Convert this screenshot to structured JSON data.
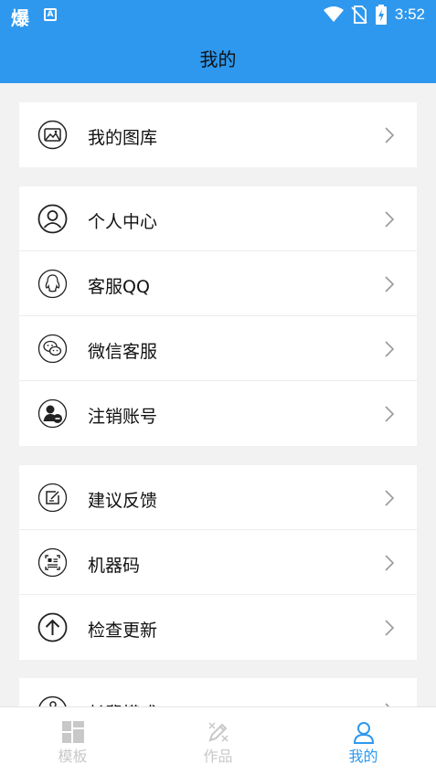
{
  "statusbar": {
    "app_glyph": "爆",
    "store_glyph": "A",
    "time": "3:52"
  },
  "header": {
    "title": "我的"
  },
  "menu_groups": [
    {
      "items": [
        {
          "label": "我的图库",
          "icon": "gallery-icon"
        }
      ]
    },
    {
      "items": [
        {
          "label": "个人中心",
          "icon": "user-icon"
        },
        {
          "label": "客服QQ",
          "icon": "qq-icon"
        },
        {
          "label": "微信客服",
          "icon": "wechat-icon"
        },
        {
          "label": "注销账号",
          "icon": "delete-account-icon"
        }
      ]
    },
    {
      "items": [
        {
          "label": "建议反馈",
          "icon": "feedback-icon"
        },
        {
          "label": "机器码",
          "icon": "machine-code-icon"
        },
        {
          "label": "检查更新",
          "icon": "update-icon"
        }
      ]
    },
    {
      "items": [
        {
          "label": "长辈模式",
          "icon": "elder-mode-icon"
        }
      ]
    }
  ],
  "tabbar": [
    {
      "label": "模板",
      "icon": "template-icon",
      "active": false
    },
    {
      "label": "作品",
      "icon": "works-icon",
      "active": false
    },
    {
      "label": "我的",
      "icon": "profile-icon",
      "active": true
    }
  ],
  "colors": {
    "accent": "#2e98ee",
    "background": "#f2f2f2",
    "tab_inactive": "#c8c8c8"
  }
}
